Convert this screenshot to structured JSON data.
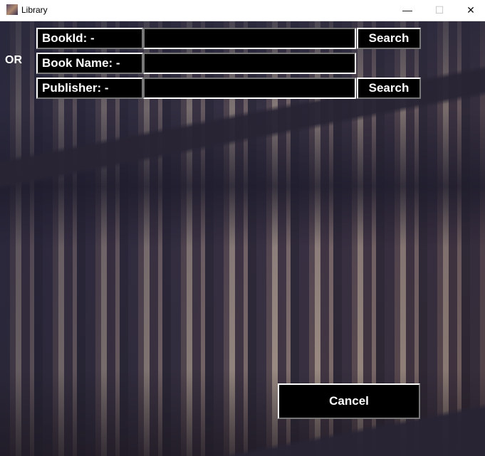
{
  "window": {
    "title": "Library",
    "minimize": "—",
    "maximize": "☐",
    "close": "✕"
  },
  "form": {
    "or_label": "OR",
    "bookid_label": "BookId: -",
    "bookname_label": "Book Name: -",
    "publisher_label": "Publisher: -",
    "bookid_value": "",
    "bookname_value": "",
    "publisher_value": "",
    "search_label": "Search",
    "search2_label": "Search",
    "cancel_label": "Cancel"
  }
}
